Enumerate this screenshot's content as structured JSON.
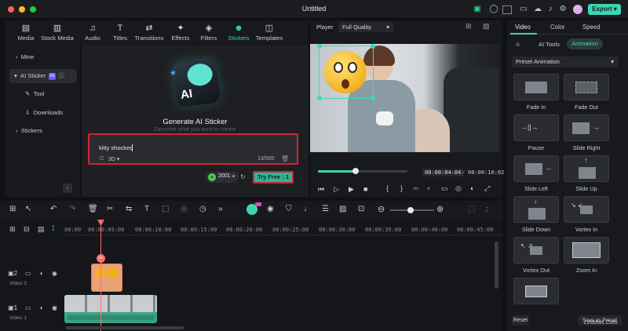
{
  "window": {
    "title": "Untitled",
    "export_label": "Export"
  },
  "media_tabs": [
    {
      "label": "Media",
      "icon": "media-icon"
    },
    {
      "label": "Stock Media",
      "icon": "stock-media-icon"
    },
    {
      "label": "Audio",
      "icon": "music-note-icon"
    },
    {
      "label": "Titles",
      "icon": "titles-icon"
    },
    {
      "label": "Transitions",
      "icon": "transitions-icon"
    },
    {
      "label": "Effects",
      "icon": "effects-icon"
    },
    {
      "label": "Filters",
      "icon": "filters-icon"
    },
    {
      "label": "Stickers",
      "icon": "stickers-icon",
      "active": true
    },
    {
      "label": "Templates",
      "icon": "templates-icon"
    }
  ],
  "sidebar": {
    "items": [
      {
        "label": "Mine"
      },
      {
        "label": "AI Sticker",
        "badge": "AI"
      },
      {
        "label": "Tool"
      },
      {
        "label": "Downloads"
      },
      {
        "label": "Stickers"
      }
    ]
  },
  "sticker_panel": {
    "heading": "Generate AI Sticker",
    "subheading": "Describe what you want to create",
    "prompt_value": "kitty shocked",
    "style_option": "3D",
    "char_count": "13/500",
    "credits": "2001",
    "try_free_label": "Try Free : 1"
  },
  "player": {
    "label": "Player",
    "quality": "Full Quality",
    "current_time": "00:00:04:04",
    "separator": "/",
    "total_time": "00:00:10:02",
    "progress": 0.42
  },
  "right_panel": {
    "tabs": [
      "Video",
      "Color",
      "Speed"
    ],
    "subtabs": [
      "AI Tools",
      "Animation"
    ],
    "preset_label": "Preset Animation",
    "effects": [
      "Fade In",
      "Fade Out",
      "Pause",
      "Slide Right",
      "Slide Left",
      "Slide Up",
      "Slide Down",
      "Vortex In",
      "Vortex Out",
      "Zoom In",
      ""
    ],
    "reset_label": "Reset",
    "preset_label_bottom": "Save as Preset",
    "watermark": "Lindows.Com"
  },
  "timeline": {
    "ticks": [
      "00:00",
      "00:00:05:00",
      "00:00:10:00",
      "00:00:15:00",
      "00:00:20:00",
      "00:00:25:00",
      "00:00:30:00",
      "00:00:35:00",
      "00:00:40:00",
      "00:00:45:00"
    ],
    "tracks": [
      {
        "label": "Video 2",
        "number": "2"
      },
      {
        "label": "Video 1",
        "number": "1"
      }
    ],
    "playhead_time_fraction": 0.09,
    "colors": {
      "accent": "#3dd6b5",
      "highlight": "#d2262e",
      "playhead": "#ff6b6b"
    }
  }
}
